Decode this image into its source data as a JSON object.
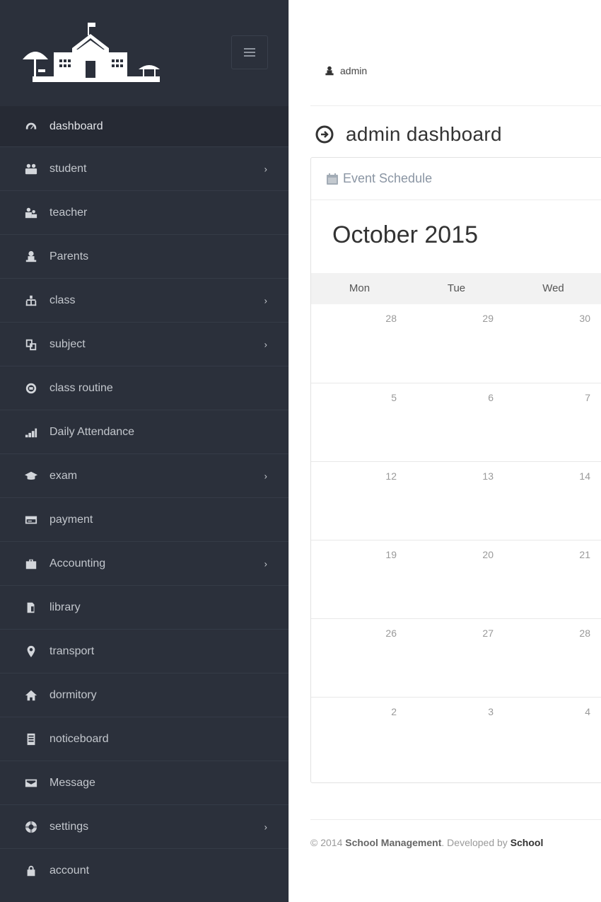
{
  "sidebar": {
    "logo_alt": "School building logo",
    "items": [
      {
        "label": "dashboard",
        "icon": "dashboard-gauge-icon",
        "active": true,
        "has_submenu": false
      },
      {
        "label": "student",
        "icon": "users-group-icon",
        "active": false,
        "has_submenu": true
      },
      {
        "label": "teacher",
        "icon": "teacher-users-icon",
        "active": false,
        "has_submenu": false
      },
      {
        "label": "Parents",
        "icon": "user-icon",
        "active": false,
        "has_submenu": false
      },
      {
        "label": "class",
        "icon": "sitemap-icon",
        "active": false,
        "has_submenu": true
      },
      {
        "label": "subject",
        "icon": "docs-icon",
        "active": false,
        "has_submenu": true
      },
      {
        "label": "class routine",
        "icon": "target-icon",
        "active": false,
        "has_submenu": false
      },
      {
        "label": "Daily Attendance",
        "icon": "signal-icon",
        "active": false,
        "has_submenu": false
      },
      {
        "label": "exam",
        "icon": "graduation-cap-icon",
        "active": false,
        "has_submenu": true
      },
      {
        "label": "payment",
        "icon": "credit-card-icon",
        "active": false,
        "has_submenu": false
      },
      {
        "label": "Accounting",
        "icon": "briefcase-icon",
        "active": false,
        "has_submenu": true
      },
      {
        "label": "library",
        "icon": "books-icon",
        "active": false,
        "has_submenu": false
      },
      {
        "label": "transport",
        "icon": "map-marker-icon",
        "active": false,
        "has_submenu": false
      },
      {
        "label": "dormitory",
        "icon": "home-icon",
        "active": false,
        "has_submenu": false
      },
      {
        "label": "noticeboard",
        "icon": "document-icon",
        "active": false,
        "has_submenu": false
      },
      {
        "label": "Message",
        "icon": "inbox-icon",
        "active": false,
        "has_submenu": false
      },
      {
        "label": "settings",
        "icon": "lifebuoy-icon",
        "active": false,
        "has_submenu": true
      },
      {
        "label": "account",
        "icon": "lock-icon",
        "active": false,
        "has_submenu": false
      }
    ],
    "chevron": "›"
  },
  "header": {
    "user_label": "admin"
  },
  "page": {
    "title": "admin dashboard"
  },
  "panel": {
    "title": "Event Schedule",
    "calendar": {
      "month_title": "October 2015",
      "weekdays": [
        "Mon",
        "Tue",
        "Wed"
      ],
      "weeks": [
        [
          "28",
          "29",
          "30"
        ],
        [
          "5",
          "6",
          "7"
        ],
        [
          "12",
          "13",
          "14"
        ],
        [
          "19",
          "20",
          "21"
        ],
        [
          "26",
          "27",
          "28"
        ],
        [
          "2",
          "3",
          "4"
        ]
      ]
    }
  },
  "footer": {
    "copyright": "© 2014 ",
    "brand": "School Management",
    "developed_by": ". Developed by ",
    "developer": "School"
  }
}
